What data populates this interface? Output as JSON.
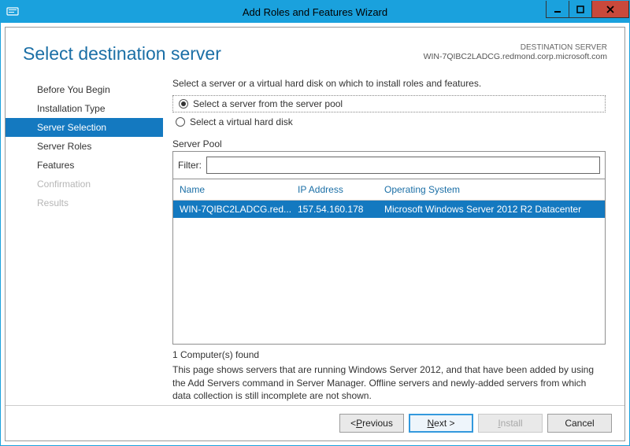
{
  "window": {
    "title": "Add Roles and Features Wizard"
  },
  "header": {
    "title": "Select destination server",
    "dest_label": "DESTINATION SERVER",
    "dest_value": "WIN-7QIBC2LADCG.redmond.corp.microsoft.com"
  },
  "nav": {
    "items": [
      {
        "label": "Before You Begin",
        "state": "normal"
      },
      {
        "label": "Installation Type",
        "state": "normal"
      },
      {
        "label": "Server Selection",
        "state": "active"
      },
      {
        "label": "Server Roles",
        "state": "normal"
      },
      {
        "label": "Features",
        "state": "normal"
      },
      {
        "label": "Confirmation",
        "state": "disabled"
      },
      {
        "label": "Results",
        "state": "disabled"
      }
    ]
  },
  "main": {
    "intro": "Select a server or a virtual hard disk on which to install roles and features.",
    "radio_pool": "Select a server from the server pool",
    "radio_vhd": "Select a virtual hard disk",
    "pool_label": "Server Pool",
    "filter_label": "Filter:",
    "columns": {
      "name": "Name",
      "ip": "IP Address",
      "os": "Operating System"
    },
    "rows": [
      {
        "name": "WIN-7QIBC2LADCG.red...",
        "ip": "157.54.160.178",
        "os": "Microsoft Windows Server 2012 R2 Datacenter"
      }
    ],
    "found": "1 Computer(s) found",
    "description": "This page shows servers that are running Windows Server 2012, and that have been added by using the Add Servers command in Server Manager. Offline servers and newly-added servers from which data collection is still incomplete are not shown."
  },
  "footer": {
    "previous_pre": "< ",
    "previous_u": "P",
    "previous_post": "revious",
    "next_u": "N",
    "next_post": "ext >",
    "install_u": "I",
    "install_post": "nstall",
    "cancel": "Cancel"
  }
}
